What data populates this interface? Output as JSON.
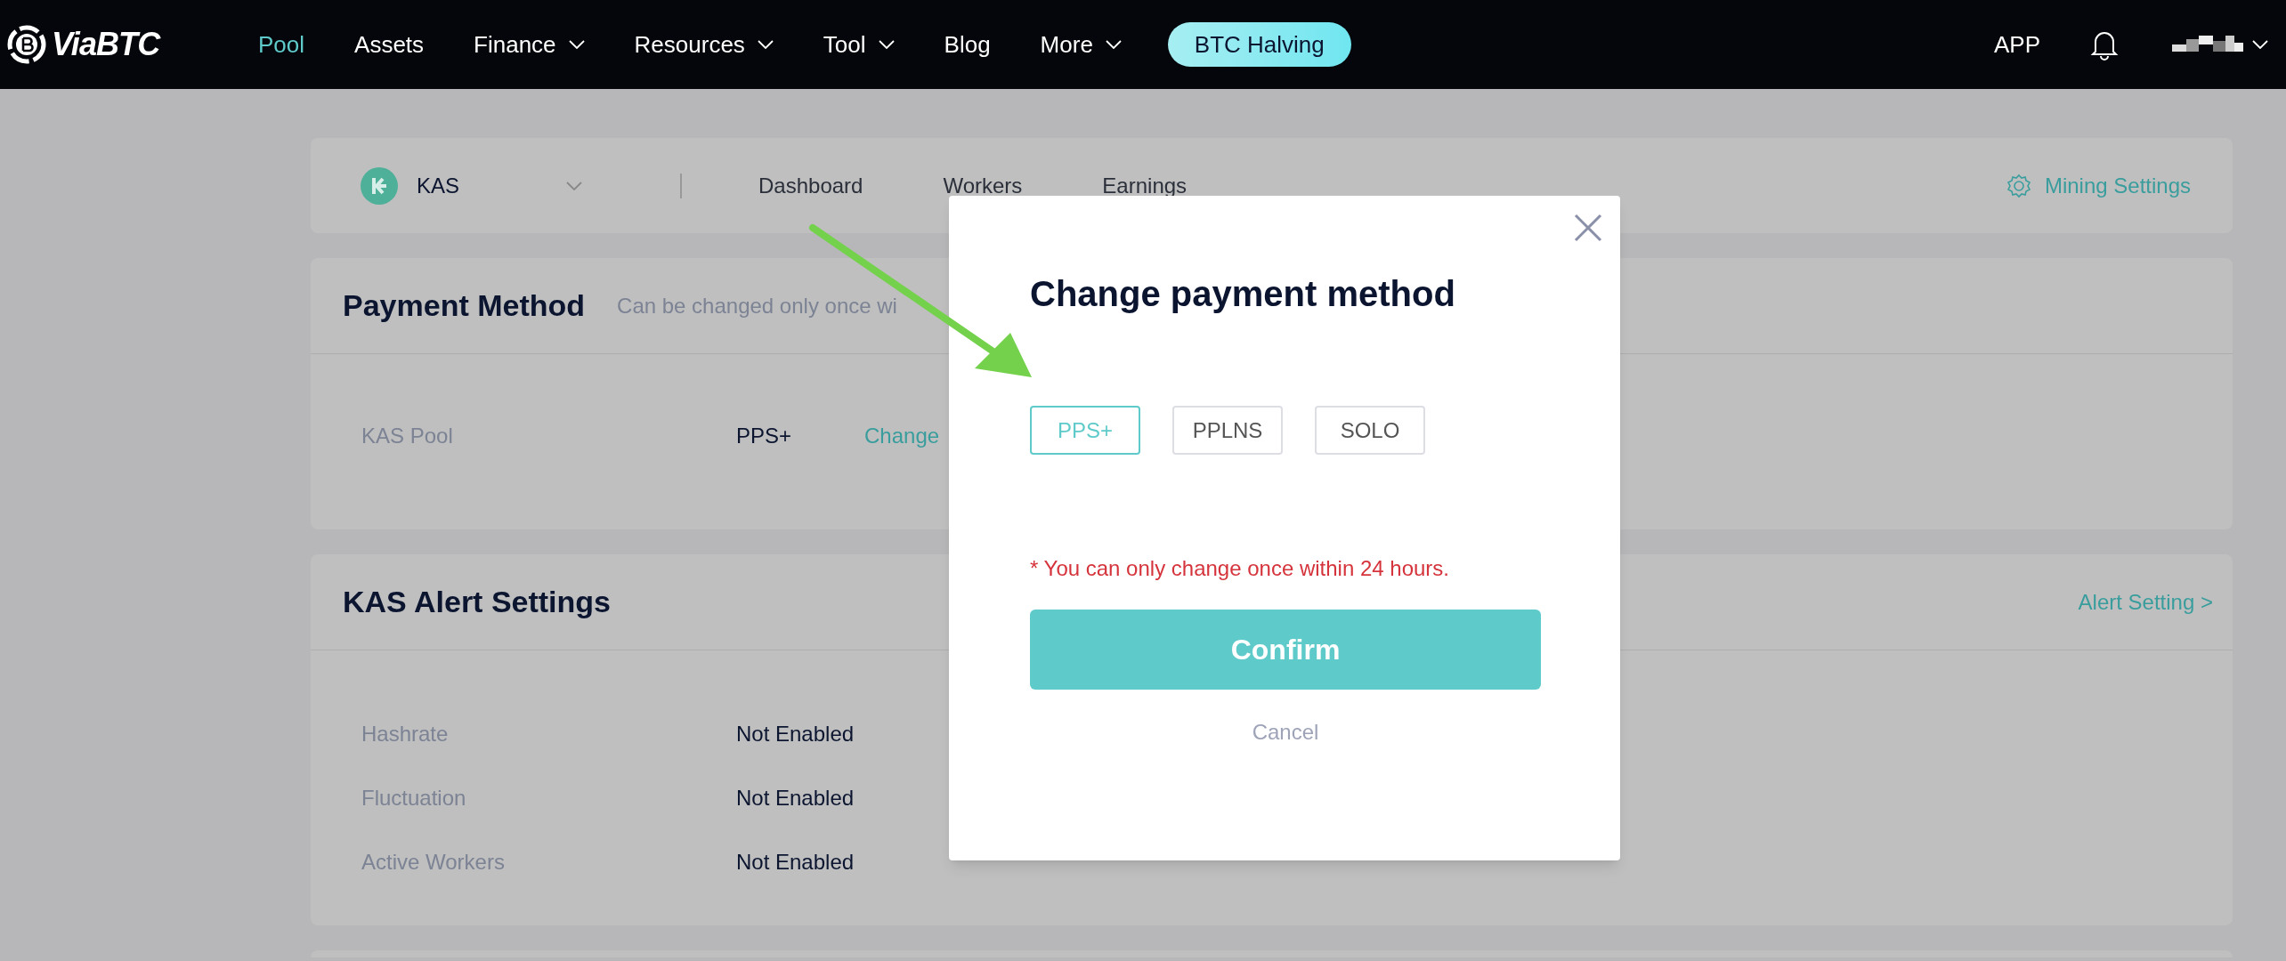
{
  "nav": {
    "logo": "ViaBTC",
    "items": [
      {
        "label": "Pool",
        "selected": true,
        "dropdown": false
      },
      {
        "label": "Assets",
        "selected": false,
        "dropdown": false
      },
      {
        "label": "Finance",
        "selected": false,
        "dropdown": true
      },
      {
        "label": "Resources",
        "selected": false,
        "dropdown": true
      },
      {
        "label": "Tool",
        "selected": false,
        "dropdown": true
      },
      {
        "label": "Blog",
        "selected": false,
        "dropdown": false
      },
      {
        "label": "More",
        "selected": false,
        "dropdown": true
      }
    ],
    "promo": "BTC Halving",
    "app": "APP"
  },
  "coin_bar": {
    "coin": "KAS",
    "tabs": [
      {
        "label": "Dashboard",
        "selected": false
      },
      {
        "label": "Workers",
        "selected": false
      },
      {
        "label": "Earnings",
        "selected": false
      }
    ],
    "settings": "Mining Settings"
  },
  "payment": {
    "title": "Payment Method",
    "note": "Can be changed only once wi",
    "rows": [
      {
        "label": "KAS Pool",
        "value": "PPS+",
        "action": "Change"
      }
    ]
  },
  "alerts": {
    "title": "KAS Alert Settings",
    "link": "Alert Setting >",
    "rows": [
      {
        "label": "Hashrate",
        "value": "Not Enabled"
      },
      {
        "label": "Fluctuation",
        "value": "Not Enabled"
      },
      {
        "label": "Active Workers",
        "value": "Not Enabled"
      }
    ]
  },
  "modal": {
    "title": "Change payment method",
    "options": [
      {
        "label": "PPS+",
        "selected": true
      },
      {
        "label": "PPLNS",
        "selected": false
      },
      {
        "label": "SOLO",
        "selected": false
      }
    ],
    "warning": "* You can only change once within 24 hours.",
    "confirm": "Confirm",
    "cancel": "Cancel"
  }
}
